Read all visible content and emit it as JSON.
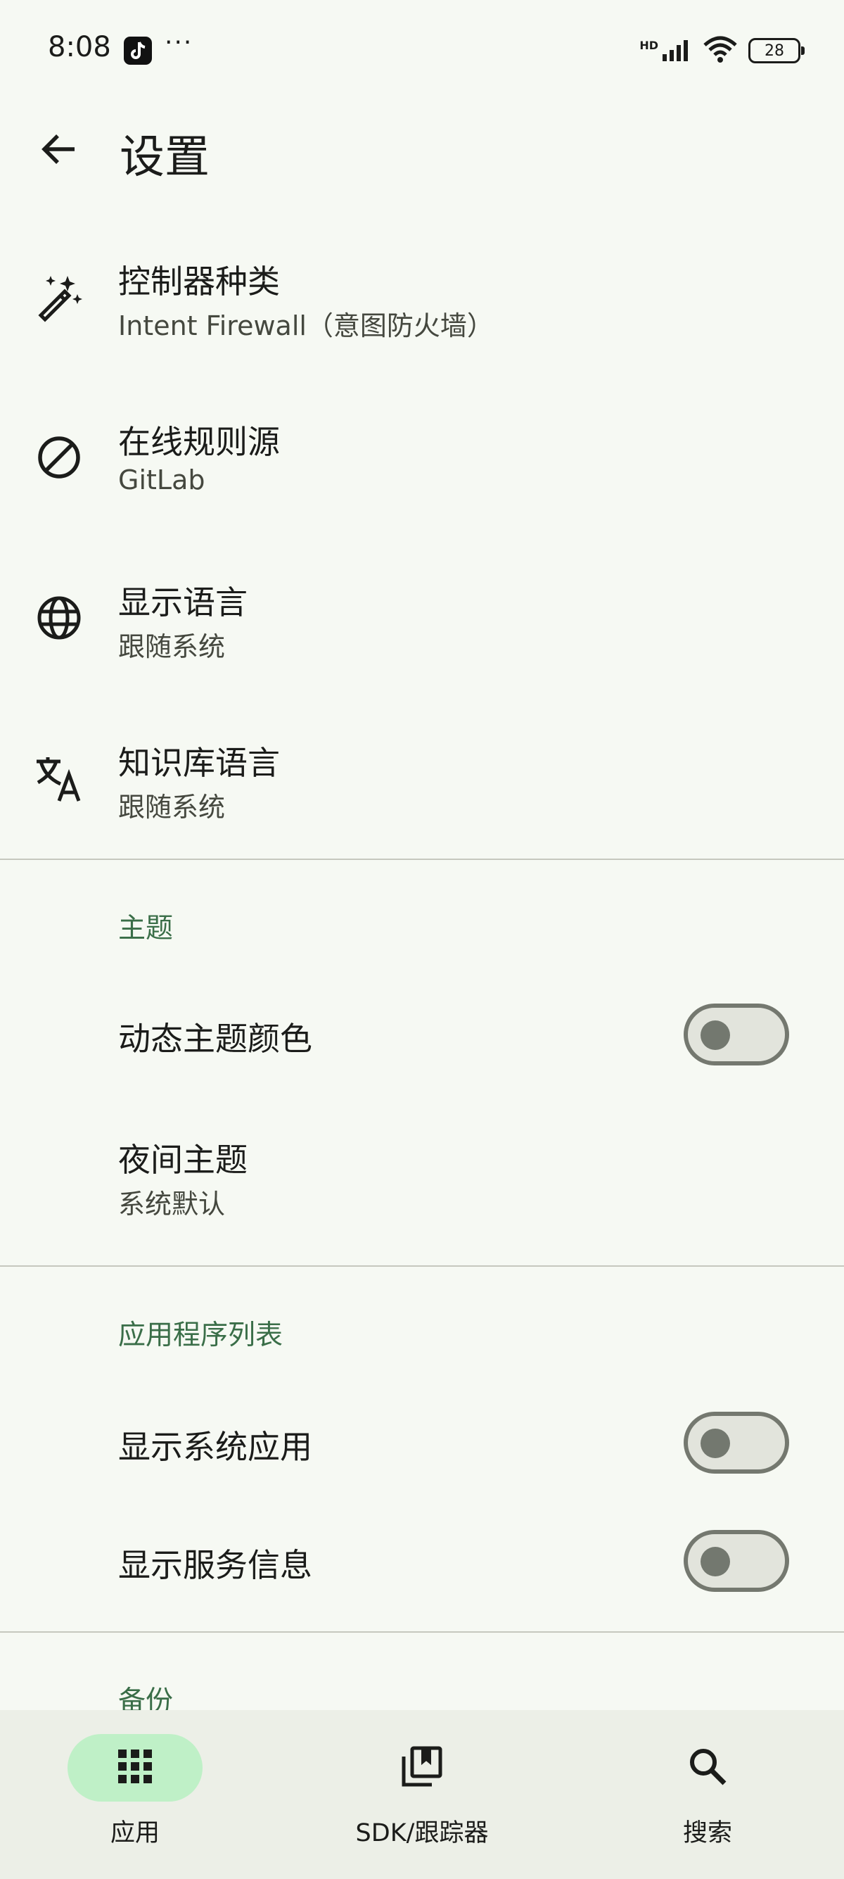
{
  "status": {
    "time": "8:08",
    "dots": "···",
    "network": "HD",
    "battery": "28"
  },
  "header": {
    "title": "设置"
  },
  "settings": [
    {
      "title": "控制器种类",
      "subtitle": "Intent Firewall（意图防火墙）"
    },
    {
      "title": "在线规则源",
      "subtitle": "GitLab"
    },
    {
      "title": "显示语言",
      "subtitle": "跟随系统"
    },
    {
      "title": "知识库语言",
      "subtitle": "跟随系统"
    }
  ],
  "theme": {
    "section": "主题",
    "dynamic_color": "动态主题颜色",
    "night_title": "夜间主题",
    "night_value": "系统默认"
  },
  "app_list": {
    "section": "应用程序列表",
    "show_system": "显示系统应用",
    "show_service": "显示服务信息"
  },
  "backup": {
    "section": "备份"
  },
  "nav": {
    "apps": "应用",
    "sdk": "SDK/跟踪器",
    "search": "搜索"
  }
}
